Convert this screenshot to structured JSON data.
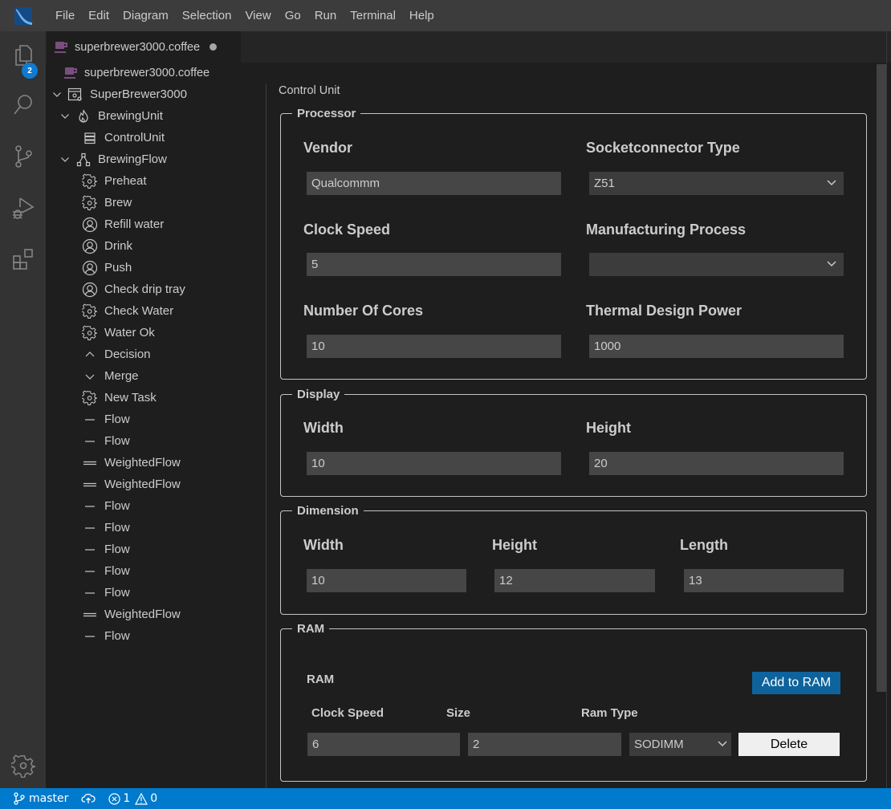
{
  "menubar": {
    "items": [
      "File",
      "Edit",
      "Diagram",
      "Selection",
      "View",
      "Go",
      "Run",
      "Terminal",
      "Help"
    ]
  },
  "activitybar": {
    "explorer_badge": "2",
    "icons": [
      "files-icon",
      "search-icon",
      "source-control-icon",
      "run-debug-icon",
      "extensions-icon",
      "settings-gear-icon"
    ]
  },
  "tab": {
    "title": "superbrewer3000.coffee",
    "dirty": true
  },
  "tree": {
    "file": "superbrewer3000.coffee",
    "items": [
      {
        "label": "SuperBrewer3000",
        "icon": "workbench-icon",
        "level": 0,
        "expanded": true
      },
      {
        "label": "BrewingUnit",
        "icon": "flame-icon",
        "level": 1,
        "expanded": true
      },
      {
        "label": "ControlUnit",
        "icon": "server-icon",
        "level": 2
      },
      {
        "label": "BrewingFlow",
        "icon": "type-hierarchy-icon",
        "level": 1,
        "expanded": true
      },
      {
        "label": "Preheat",
        "icon": "gear-icon",
        "level": 2
      },
      {
        "label": "Brew",
        "icon": "gear-icon",
        "level": 2
      },
      {
        "label": "Refill water",
        "icon": "account-icon",
        "level": 2
      },
      {
        "label": "Drink",
        "icon": "account-icon",
        "level": 2
      },
      {
        "label": "Push",
        "icon": "account-icon",
        "level": 2
      },
      {
        "label": "Check drip tray",
        "icon": "account-icon",
        "level": 2
      },
      {
        "label": "Check Water",
        "icon": "gear-icon",
        "level": 2
      },
      {
        "label": "Water Ok",
        "icon": "gear-icon",
        "level": 2
      },
      {
        "label": "Decision",
        "icon": "chevron-up-icon",
        "level": 2
      },
      {
        "label": "Merge",
        "icon": "chevron-down-icon",
        "level": 2
      },
      {
        "label": "New Task",
        "icon": "gear-icon",
        "level": 2
      },
      {
        "label": "Flow",
        "icon": "dash-icon",
        "level": 2
      },
      {
        "label": "Flow",
        "icon": "dash-icon",
        "level": 2
      },
      {
        "label": "WeightedFlow",
        "icon": "double-line-icon",
        "level": 2
      },
      {
        "label": "WeightedFlow",
        "icon": "double-line-icon",
        "level": 2
      },
      {
        "label": "Flow",
        "icon": "dash-icon",
        "level": 2
      },
      {
        "label": "Flow",
        "icon": "dash-icon",
        "level": 2
      },
      {
        "label": "Flow",
        "icon": "dash-icon",
        "level": 2
      },
      {
        "label": "Flow",
        "icon": "dash-icon",
        "level": 2
      },
      {
        "label": "Flow",
        "icon": "dash-icon",
        "level": 2
      },
      {
        "label": "WeightedFlow",
        "icon": "double-line-icon",
        "level": 2
      },
      {
        "label": "Flow",
        "icon": "dash-icon",
        "level": 2
      }
    ]
  },
  "form": {
    "title": "Control Unit",
    "processor": {
      "legend": "Processor",
      "vendor": {
        "label": "Vendor",
        "value": "Qualcommm"
      },
      "socket": {
        "label": "Socketconnector Type",
        "value": "Z51"
      },
      "clock": {
        "label": "Clock Speed",
        "value": "5"
      },
      "manufacturing": {
        "label": "Manufacturing Process",
        "value": ""
      },
      "cores": {
        "label": "Number Of Cores",
        "value": "10"
      },
      "tdp": {
        "label": "Thermal Design Power",
        "value": "1000"
      }
    },
    "display": {
      "legend": "Display",
      "width": {
        "label": "Width",
        "value": "10"
      },
      "height": {
        "label": "Height",
        "value": "20"
      }
    },
    "dimension": {
      "legend": "Dimension",
      "width": {
        "label": "Width",
        "value": "10"
      },
      "height": {
        "label": "Height",
        "value": "12"
      },
      "length": {
        "label": "Length",
        "value": "13"
      }
    },
    "ram": {
      "legend": "RAM",
      "heading": "RAM",
      "add_button": "Add to RAM",
      "columns": [
        "Clock Speed",
        "Size",
        "Ram Type"
      ],
      "rows": [
        {
          "clock_speed": "6",
          "size": "2",
          "ram_type": "SODIMM",
          "delete_label": "Delete"
        }
      ]
    }
  },
  "statusbar": {
    "branch": "master",
    "errors": "1",
    "warnings": "0"
  },
  "colors": {
    "accent": "#007acc",
    "button_primary": "#0e639c",
    "badge": "#0e7ad3",
    "file_icon": "#7a4f7e"
  }
}
